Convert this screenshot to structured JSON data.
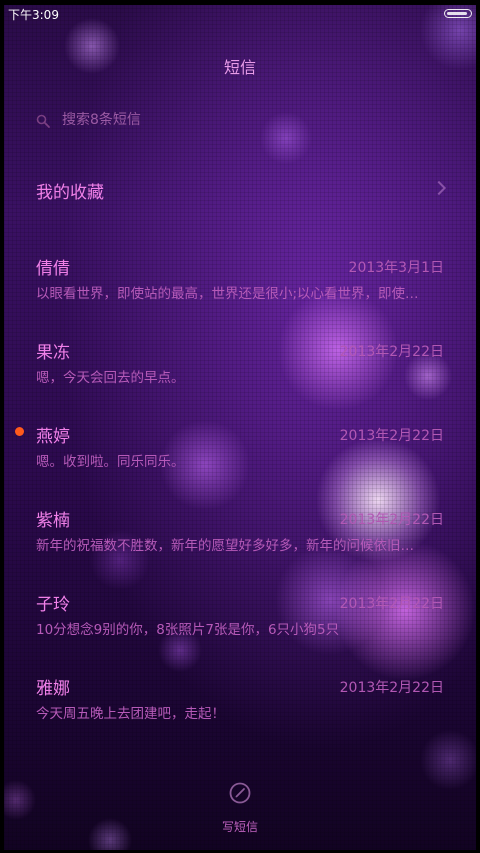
{
  "status_bar": {
    "time": "下午3:09",
    "battery_level": 0.9
  },
  "header": {
    "title": "短信"
  },
  "search": {
    "placeholder": "搜索8条短信"
  },
  "favorites": {
    "label": "我的收藏"
  },
  "threads": [
    {
      "name": "倩倩",
      "date": "2013年3月1日",
      "preview": "以眼看世界，即使站的最高，世界还是很小;以心看世界，即使…",
      "unread": false
    },
    {
      "name": "果冻",
      "date": "2013年2月22日",
      "preview": "嗯，今天会回去的早点。",
      "unread": false
    },
    {
      "name": "燕婷",
      "date": "2013年2月22日",
      "preview": "嗯。收到啦。同乐同乐。",
      "unread": true
    },
    {
      "name": "紫楠",
      "date": "2013年2月22日",
      "preview": "新年的祝福数不胜数，新年的愿望好多好多，新年的问候依旧…",
      "unread": false
    },
    {
      "name": "子玲",
      "date": "2013年2月22日",
      "preview": "10分想念9别的你，8张照片7张是你，6只小狗5只",
      "unread": false
    },
    {
      "name": "雅娜",
      "date": "2013年2月22日",
      "preview": "今天周五晚上去团建吧，走起！",
      "unread": false
    }
  ],
  "compose": {
    "label": "写短信"
  },
  "colors": {
    "accent": "#f080e8",
    "secondary": "#b65ab8",
    "unread_dot": "#ff5a1c"
  }
}
